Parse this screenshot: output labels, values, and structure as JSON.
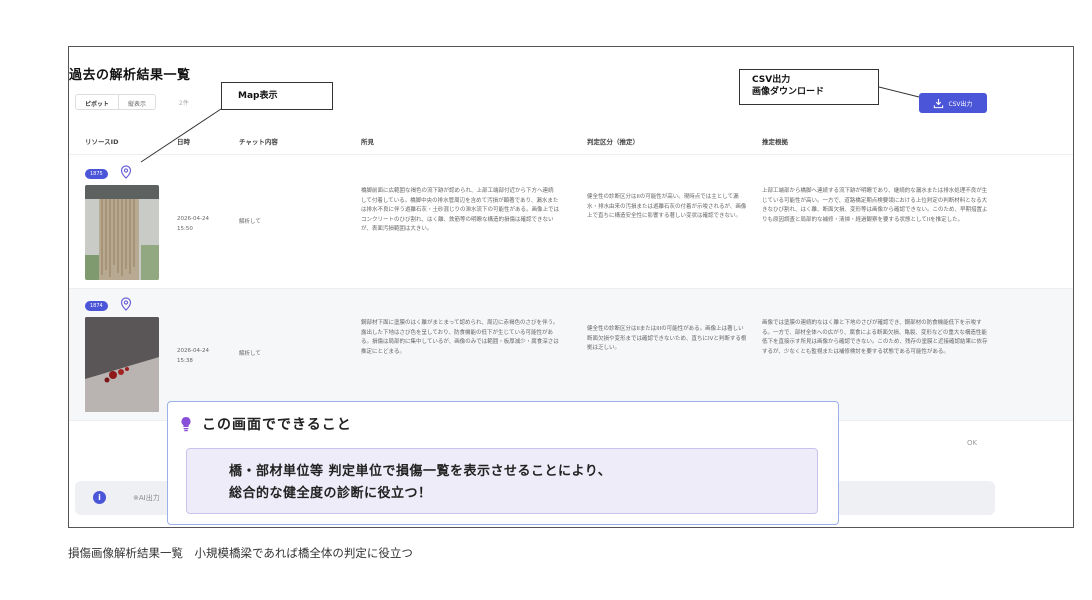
{
  "page": {
    "title": "過去の解析結果一覧",
    "caption": "損傷画像解析結果一覧　小規模橋梁であれば橋全体の判定に役立つ"
  },
  "toolbar": {
    "view_toggle": [
      "ピボット",
      "縦表示"
    ],
    "count": "2件",
    "csv_button": "CSV出力"
  },
  "table": {
    "headers": [
      "リソースID",
      "日時",
      "チャット内容",
      "所見",
      "判定区分（推定）",
      "推定根拠"
    ],
    "rows": [
      {
        "badge": "1875",
        "date": "2026-04-24",
        "time": "15:50",
        "chat": "解析して",
        "finding": "橋脚前面に広範囲な褐色の流下跡が認められ、上部工端部付近から下方へ連続して付着している。橋脚中央の排水管周辺を含めて汚損が顕著であり、漏水または排水不良に伴う遊離石灰・土砂混じりの滞水流下の可能性がある。画像上ではコンクリートのひび割れ、はく離、鉄筋等の明瞭な構造的損傷は確認できないが、表面汚損範囲は大きい。",
        "judgement": "健全性の診断区分はIIの可能性が高い。現時点では主として漏水・排水由来の汚損または遊離石灰の付着が示唆されるが、画像上で直ちに構造安全性に影響する著しい変状は確認できない。",
        "basis": "上部工端部から橋脚へ連続する流下跡が明瞭であり、継続的な漏水または排水処理不良が生じている可能性が高い。一方で、道路橋定期点検要領における上位判定の判断材料となる大きなひび割れ、はく離、断面欠損、変形等は画像から確認できない。このため、早期措置よりも原因調査と局部的な補修・清掃・経過観察を要する状態としてIIを推定した。"
      },
      {
        "badge": "1874",
        "date": "2026-04-24",
        "time": "15:38",
        "chat": "解析して",
        "finding": "鋼部材下面に塗膜のはく離がまとまって認められ、周辺に赤褐色のさびを伴う。露出した下地はさび色を呈しており、防食機能の低下が生じている可能性がある。損傷は局部的に集中しているが、画像のみでは範囲・板厚減少・腐食深さは推定にとどまる。",
        "judgement": "健全性の診断区分はIIまたはIIIの可能性がある。画像上は著しい断面欠損や変形までは確認できないため、直ちにIVと判断する根拠は乏しい。",
        "basis": "画像では塗膜の連続的なはく離と下地のさびが確認でき、鋼部材の防食機能低下を示唆する。一方で、部材全体への広がり、腐食による断面欠損、亀裂、変形などの重大な構造性能低下を直接示す所見は画像から確認できない。このため、残存の塗膜と近接確認結果に依存するが、少なくとも監視または補修検討を要する状態である可能性がある。"
      }
    ]
  },
  "annotations": {
    "map": "Map表示",
    "csv_line1": "CSV出力",
    "csv_line2": "画像ダウンロード"
  },
  "can_do": {
    "title": "この画面でできること",
    "line1": "橋・部材単位等 判定単位で損傷一覧を表示させることにより、",
    "line2": "総合的な健全度の診断に役立つ！"
  },
  "footer": {
    "ok": "OK",
    "hint": "※AI出力"
  },
  "colors": {
    "accent": "#4a55d8",
    "callout_border": "#9bb0e8",
    "callout_fill": "#eeecf8"
  }
}
